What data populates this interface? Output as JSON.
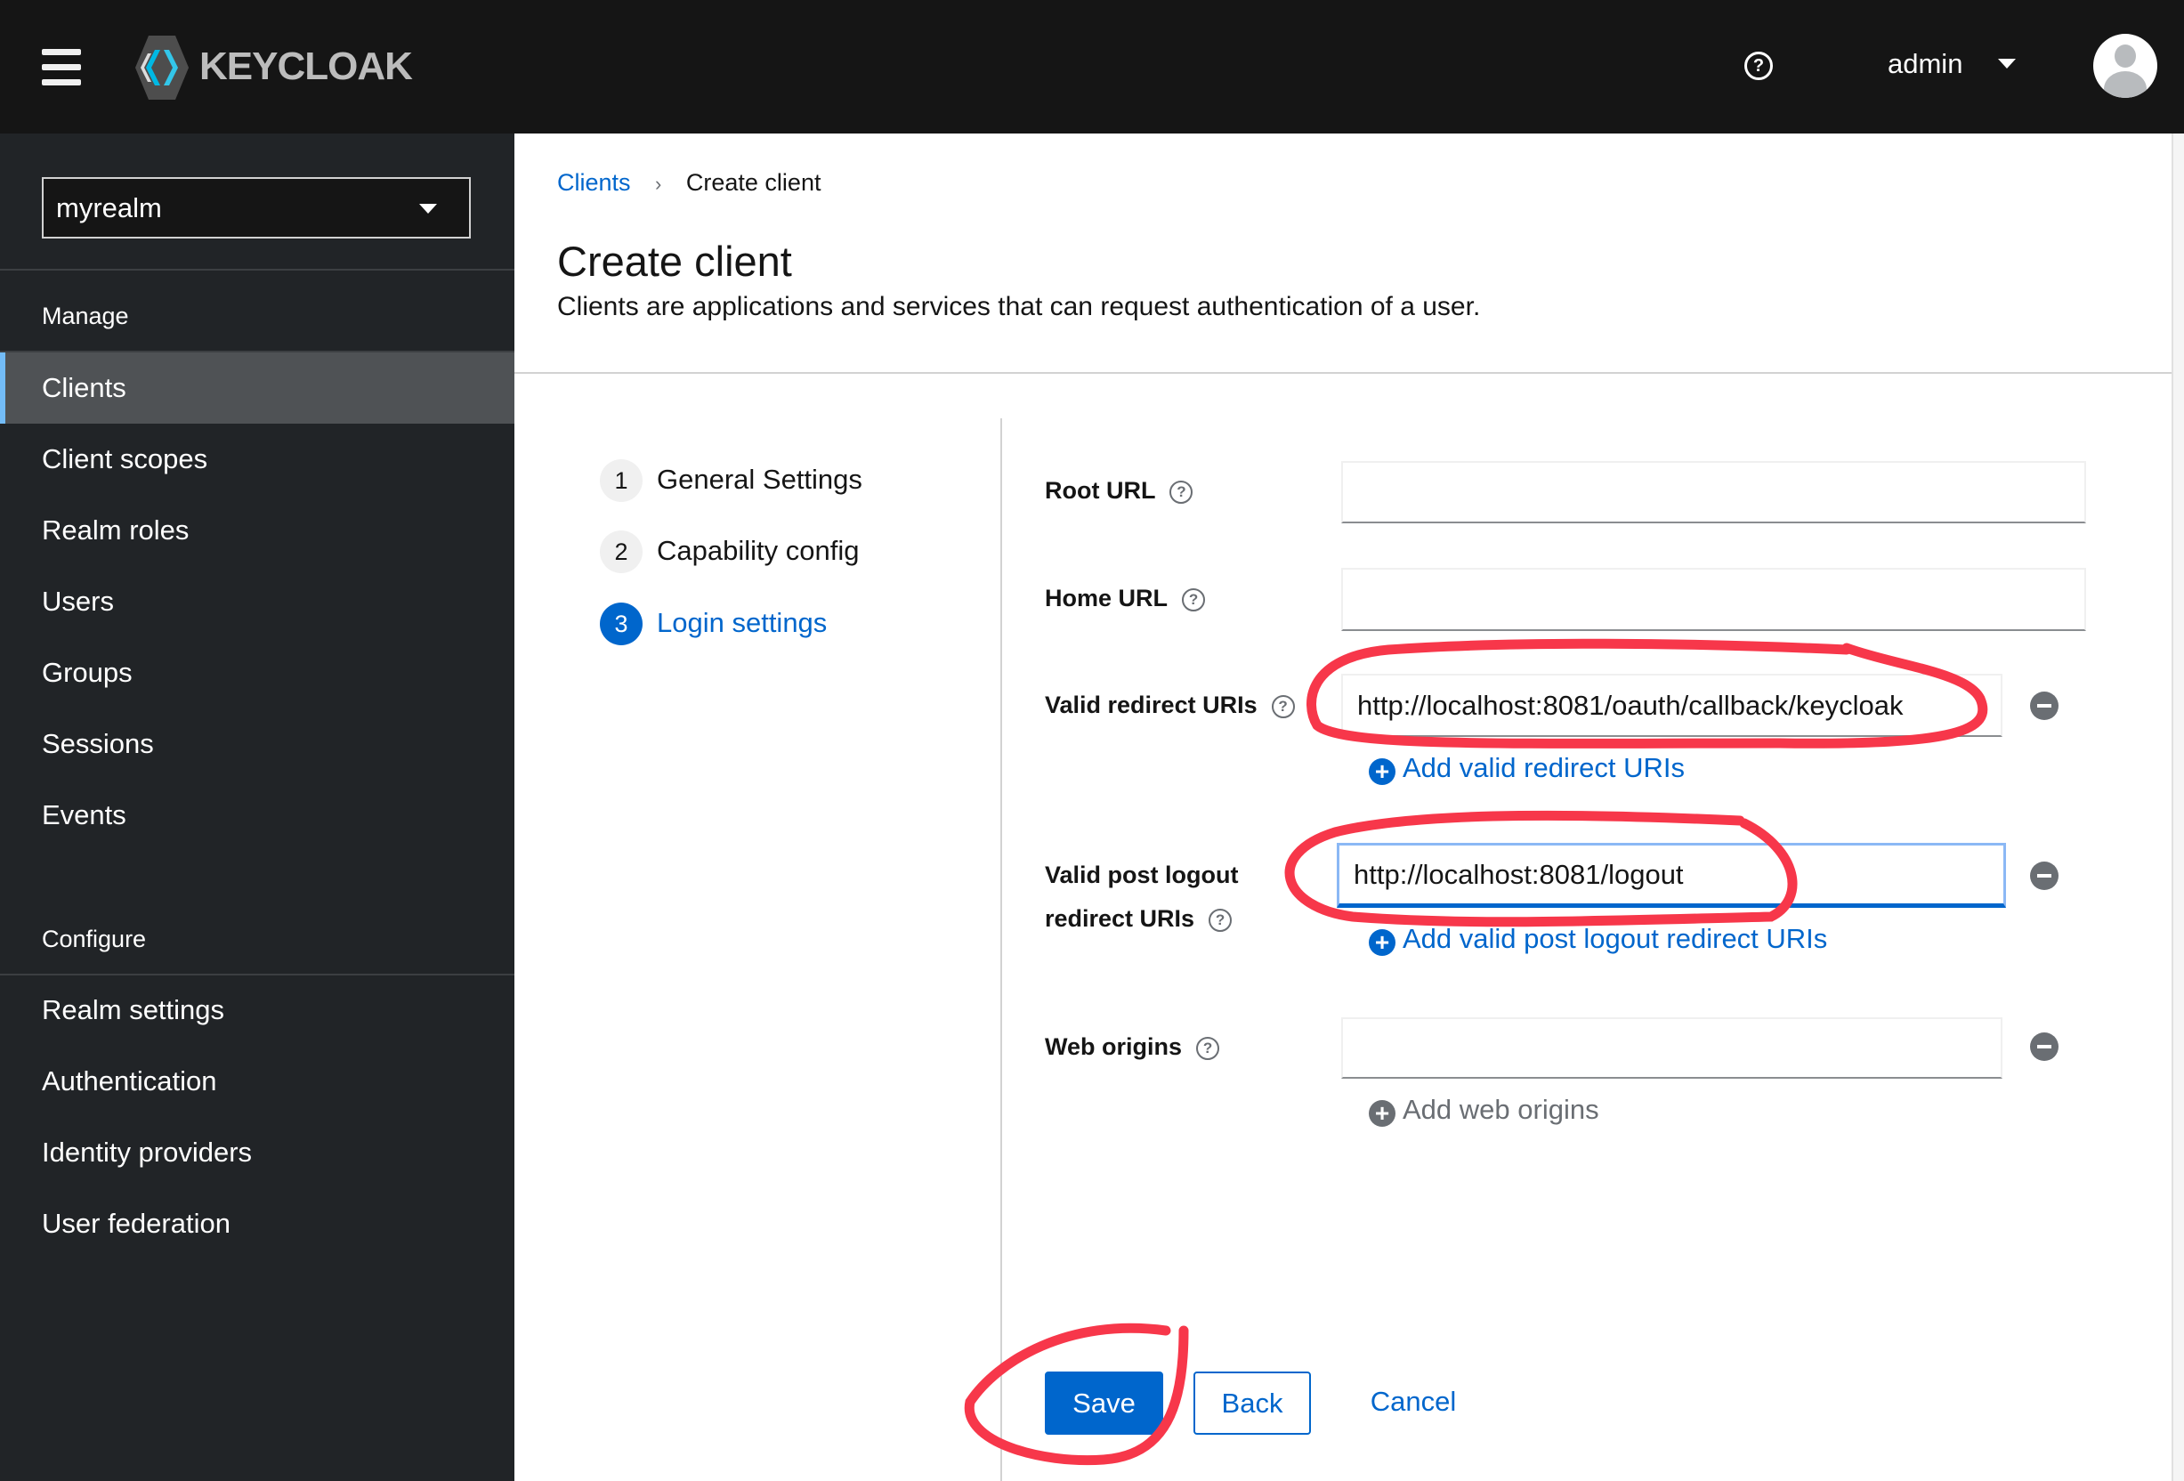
{
  "header": {
    "brand": "KEYCLOAK",
    "user": "admin",
    "icons": [
      "menu-icon",
      "help-icon",
      "caret-down-icon",
      "avatar-icon"
    ]
  },
  "sidebar": {
    "realm": "myrealm",
    "manage_label": "Manage",
    "manage_items": [
      "Clients",
      "Client scopes",
      "Realm roles",
      "Users",
      "Groups",
      "Sessions",
      "Events"
    ],
    "configure_label": "Configure",
    "configure_items": [
      "Realm settings",
      "Authentication",
      "Identity providers",
      "User federation"
    ],
    "active": "Clients"
  },
  "breadcrumb": {
    "parent": "Clients",
    "current": "Create client"
  },
  "page": {
    "title": "Create client",
    "subtitle": "Clients are applications and services that can request authentication of a user."
  },
  "wizard": {
    "steps": [
      {
        "num": "1",
        "label": "General Settings"
      },
      {
        "num": "2",
        "label": "Capability config"
      },
      {
        "num": "3",
        "label": "Login settings"
      }
    ],
    "active_step": 3
  },
  "form": {
    "root_url": {
      "label": "Root URL",
      "value": ""
    },
    "home_url": {
      "label": "Home URL",
      "value": ""
    },
    "redirect": {
      "label": "Valid redirect URIs",
      "value": "http://localhost:8081/oauth/callback/keycloak",
      "add": "Add valid redirect URIs"
    },
    "post_logout": {
      "label1": "Valid post logout",
      "label2": "redirect URIs",
      "value": "http://localhost:8081/logout",
      "add": "Add valid post logout redirect URIs"
    },
    "web_origins": {
      "label": "Web origins",
      "value": "",
      "add": "Add web origins"
    }
  },
  "actions": {
    "save": "Save",
    "back": "Back",
    "cancel": "Cancel"
  },
  "colors": {
    "accent": "#0066cc",
    "annotation": "#f7374a",
    "header": "#151515",
    "sidebar": "#212427"
  }
}
